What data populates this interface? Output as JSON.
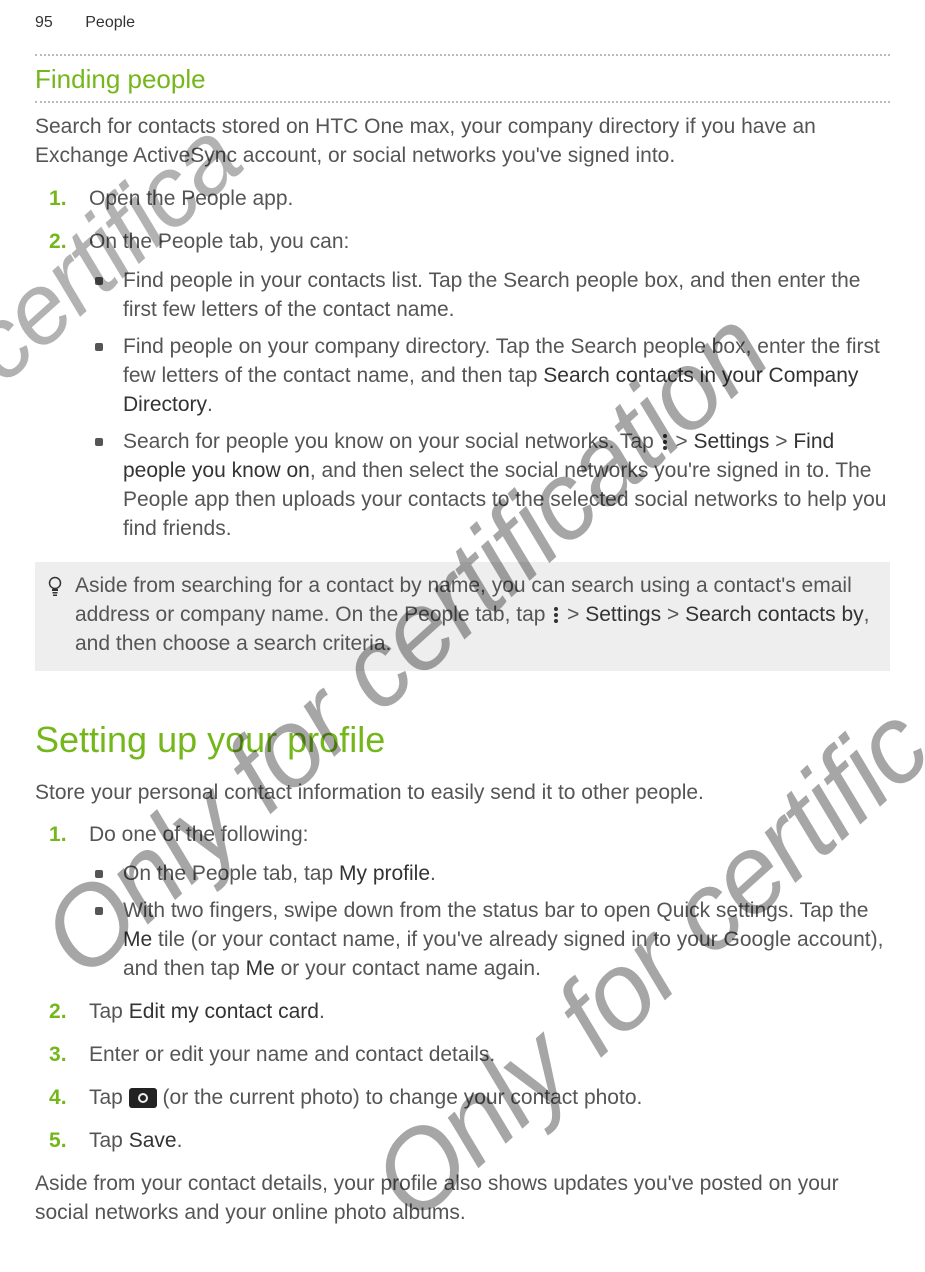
{
  "header": {
    "page_number": "95",
    "section": "People"
  },
  "watermarks": {
    "wm1": "for certifica",
    "wm2": "Only for certification",
    "wm3": "Only for certific"
  },
  "finding": {
    "title": "Finding people",
    "intro": "Search for contacts stored on HTC One max, your company directory if you have an Exchange ActiveSync account, or social networks you've signed into.",
    "steps": {
      "s1": "Open the People app.",
      "s2": "On the People tab, you can:"
    },
    "bullets": {
      "b1": "Find people in your contacts list. Tap the Search people box, and then enter the first few letters of the contact name.",
      "b2_pre": "Find people on your company directory. Tap the Search people box, enter the first few letters of the contact name, and then tap ",
      "b2_bold": "Search contacts in your Company Directory",
      "b2_post": ".",
      "b3_pre": "Search for people you know on your social networks. Tap ",
      "b3_mid1": " > ",
      "b3_bold1": "Settings",
      "b3_mid2": " > ",
      "b3_bold2": "Find people you know on",
      "b3_post": ", and then select the social networks you're signed in to. The People app then uploads your contacts to the selected social networks to help you find friends."
    },
    "tip": {
      "pre": "Aside from searching for a contact by name, you can search using a contact's email address or company name. On the People tab, tap ",
      "mid1": " > ",
      "bold1": "Settings",
      "mid2": " > ",
      "bold2": "Search contacts by",
      "post": ", and then choose a search criteria."
    }
  },
  "profile": {
    "title": "Setting up your profile",
    "intro": "Store your personal contact information to easily send it to other people.",
    "steps": {
      "s1": "Do one of the following:",
      "s2_pre": "Tap ",
      "s2_bold": "Edit my contact card",
      "s2_post": ".",
      "s3": "Enter or edit your name and contact details.",
      "s4_pre": "Tap ",
      "s4_post": " (or the current photo) to change your contact photo.",
      "s5_pre": "Tap ",
      "s5_bold": "Save",
      "s5_post": "."
    },
    "bullets": {
      "b1_pre": "On the People tab, tap ",
      "b1_bold": "My profile",
      "b1_post": ".",
      "b2_pre": "With two fingers, swipe down from the status bar to open Quick settings. Tap the ",
      "b2_bold1": "Me",
      "b2_mid": " tile (or your contact name, if you've already signed in to your Google account), and then tap ",
      "b2_bold2": "Me",
      "b2_post": " or your contact name again."
    },
    "outro": "Aside from your contact details, your profile also shows updates you've posted on your social networks and your online photo albums."
  }
}
